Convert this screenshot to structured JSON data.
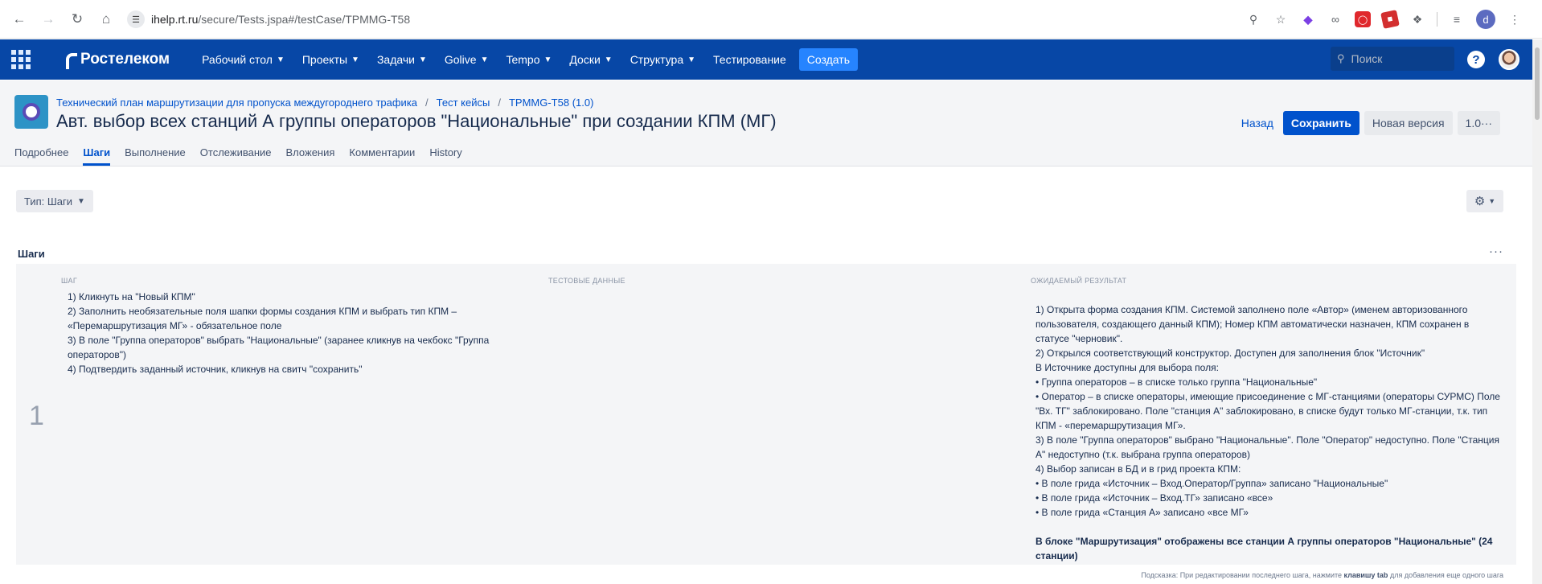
{
  "browser": {
    "url_host": "ihelp.rt.ru",
    "url_path": "/secure/Tests.jspa#/testCase/TPMMG-T58",
    "profile_initial": "d"
  },
  "topnav": {
    "logo": "Ростелеком",
    "menu": [
      {
        "label": "Рабочий стол",
        "dropdown": true
      },
      {
        "label": "Проекты",
        "dropdown": true
      },
      {
        "label": "Задачи",
        "dropdown": true
      },
      {
        "label": "Golive",
        "dropdown": true
      },
      {
        "label": "Tempo",
        "dropdown": true
      },
      {
        "label": "Доски",
        "dropdown": true
      },
      {
        "label": "Структура",
        "dropdown": true
      },
      {
        "label": "Тестирование",
        "dropdown": false
      }
    ],
    "create_label": "Создать",
    "search_placeholder": "Поиск",
    "help_label": "?"
  },
  "header": {
    "breadcrumb": [
      "Технический план маршрутизации для пропуска междугороднего трафика",
      "Тест кейсы",
      "TPMMG-T58 (1.0)"
    ],
    "title": "Авт. выбор всех станций А группы операторов \"Национальные\" при создании КПМ (МГ)",
    "back_label": "Назад",
    "save_label": "Сохранить",
    "new_version_label": "Новая версия",
    "version_label": "1.0",
    "more_label": "···"
  },
  "tabs": [
    {
      "label": "Подробнее",
      "active": false
    },
    {
      "label": "Шаги",
      "active": true
    },
    {
      "label": "Выполнение",
      "active": false
    },
    {
      "label": "Отслеживание",
      "active": false
    },
    {
      "label": "Вложения",
      "active": false
    },
    {
      "label": "Комментарии",
      "active": false
    },
    {
      "label": "History",
      "active": false
    }
  ],
  "toolbar": {
    "type_label": "Тип: Шаги"
  },
  "steps_section": {
    "title": "Шаги",
    "more_label": "···",
    "columns": {
      "step": "Шаг",
      "test_data": "Тестовые данные",
      "expected": "Ожидаемый результат"
    },
    "step_number": "1",
    "step_text": "1) Кликнуть на \"Новый КПМ\"\n2) Заполнить необязательные поля шапки формы создания КПМ и выбрать тип КПМ – «Перемаршрутизация МГ» - обязательное поле\n3) В поле \"Группа операторов\" выбрать \"Национальные\" (заранее кликнув на чекбокс \"Группа операторов\")\n4) Подтвердить заданный источник, кликнув на свитч \"сохранить\"",
    "expected_text": "1) Открыта форма создания КПМ. Системой заполнено поле «Автор» (именем авторизованного пользователя, создающего данный КПМ); Номер КПМ автоматически назначен, КПМ сохранен в статусе \"черновик\".\n2) Открылся соответствующий конструктор. Доступен для заполнения блок \"Источник\"\nВ Источнике доступны для выбора поля:\n• Группа операторов – в списке только группа \"Национальные\"\n• Оператор – в списке операторы, имеющие присоединение с МГ-станциями (операторы СУРМС) Поле \"Вх. ТГ\" заблокировано. Поле \"станция А\" заблокировано, в списке будут только МГ-станции, т.к. тип КПМ - «перемаршрутизация МГ».\n3) В поле \"Группа операторов\" выбрано \"Национальные\". Поле \"Оператор\" недоступно. Поле \"Станция А\" недоступно (т.к. выбрана группа операторов)\n4) Выбор записан в БД и в грид проекта КПМ:\n• В поле грида «Источник – Вход.Оператор/Группа» записано \"Национальные\"\n• В поле грида «Источник – Вход.ТГ» записано «все»\n• В поле грида «Станция А» записано «все МГ»",
    "expected_bold": "В блоке \"Маршрутизация\" отображены все станции А группы операторов \"Национальные\" (24 станции)",
    "hint_prefix": "Подсказка: При редактировании последнего шага, нажмите ",
    "hint_key": "клавишу tab",
    "hint_suffix": " для добавления еще одного шага"
  }
}
